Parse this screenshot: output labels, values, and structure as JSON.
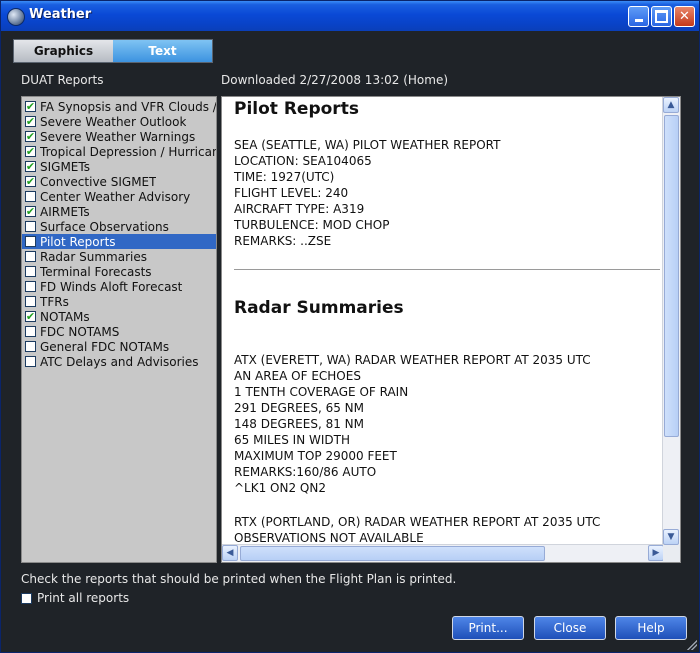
{
  "window": {
    "title": "Weather"
  },
  "tabs": [
    {
      "label": "Graphics",
      "active": false
    },
    {
      "label": "Text",
      "active": true
    }
  ],
  "list_label": "DUAT Reports",
  "downloaded_label": "Downloaded 2/27/2008 13:02 (Home)",
  "reports": [
    {
      "label": "FA Synopsis and VFR Clouds /",
      "checked": true
    },
    {
      "label": "Severe Weather Outlook",
      "checked": true
    },
    {
      "label": "Severe Weather Warnings",
      "checked": true
    },
    {
      "label": "Tropical Depression / Hurrican",
      "checked": true
    },
    {
      "label": "SIGMETs",
      "checked": true
    },
    {
      "label": "Convective SIGMET",
      "checked": true
    },
    {
      "label": "Center Weather Advisory",
      "checked": false
    },
    {
      "label": "AIRMETs",
      "checked": true
    },
    {
      "label": "Surface Observations",
      "checked": false
    },
    {
      "label": "Pilot Reports",
      "checked": false,
      "selected": true
    },
    {
      "label": "Radar Summaries",
      "checked": false
    },
    {
      "label": "Terminal Forecasts",
      "checked": false
    },
    {
      "label": "FD Winds Aloft Forecast",
      "checked": false
    },
    {
      "label": "TFRs",
      "checked": false
    },
    {
      "label": "NOTAMs",
      "checked": true
    },
    {
      "label": "FDC NOTAMS",
      "checked": false
    },
    {
      "label": "General FDC NOTAMs",
      "checked": false
    },
    {
      "label": "ATC Delays and Advisories",
      "checked": false
    }
  ],
  "content": {
    "pilot_reports": {
      "heading": "Pilot Reports",
      "lines": [
        "SEA (SEATTLE, WA) PILOT WEATHER REPORT",
        "LOCATION: SEA104065",
        "TIME: 1927(UTC)",
        "FLIGHT LEVEL: 240",
        "AIRCRAFT TYPE: A319",
        "TURBULENCE: MOD CHOP",
        "REMARKS: ..ZSE"
      ]
    },
    "radar_summaries": {
      "heading": "Radar Summaries",
      "lines": [
        "ATX (EVERETT, WA) RADAR WEATHER REPORT AT 2035 UTC",
        "AN AREA OF ECHOES",
        "1 TENTH COVERAGE OF RAIN",
        "291 DEGREES, 65 NM",
        "148 DEGREES, 81 NM",
        "65 MILES IN WIDTH",
        "MAXIMUM TOP 29000 FEET",
        "REMARKS:160/86 AUTO",
        "^LK1 ON2 QN2"
      ],
      "lines2": [
        "RTX (PORTLAND, OR) RADAR WEATHER REPORT AT 2035 UTC",
        "OBSERVATIONS NOT AVAILABLE"
      ]
    }
  },
  "footer": {
    "note": "Check the reports that should be printed when the Flight Plan is printed.",
    "print_all_label": "Print all reports"
  },
  "buttons": {
    "print": "Print...",
    "close": "Close",
    "help": "Help"
  }
}
